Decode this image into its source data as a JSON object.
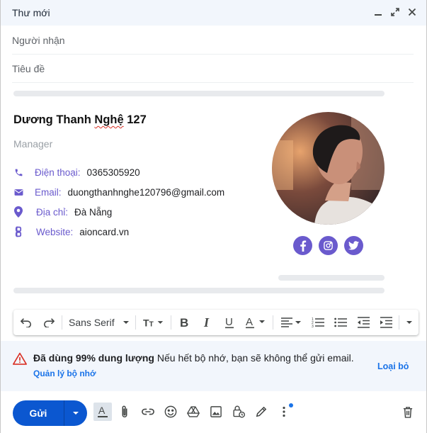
{
  "header": {
    "title": "Thư mới"
  },
  "fields": {
    "to_placeholder": "Người nhận",
    "subject_placeholder": "Tiêu đề"
  },
  "signature": {
    "name_prefix": "Dương Thanh ",
    "name_misspelled": "Nghệ",
    "name_suffix": " 127",
    "role": "Manager",
    "rows": [
      {
        "label": "Điện thoại:",
        "value": "0365305920"
      },
      {
        "label": "Email:",
        "value": "duongthanhnghe120796@gmail.com"
      },
      {
        "label": "Địa chỉ:",
        "value": "Đà Nẵng"
      },
      {
        "label": "Website:",
        "value": "aioncard.vn"
      }
    ]
  },
  "toolbar": {
    "font": "Sans Serif"
  },
  "warning": {
    "bold": "Đã dùng 99% dung lượng",
    "text": " Nếu hết bộ nhớ, bạn sẽ không thể gửi email.",
    "manage": "Quản lý bộ nhớ",
    "dismiss": "Loại bỏ"
  },
  "footer": {
    "send_label": "Gửi"
  },
  "colors": {
    "accent": "#6a5acd",
    "send": "#0b57d0",
    "link": "#1a73e8",
    "warning": "#d93025"
  }
}
